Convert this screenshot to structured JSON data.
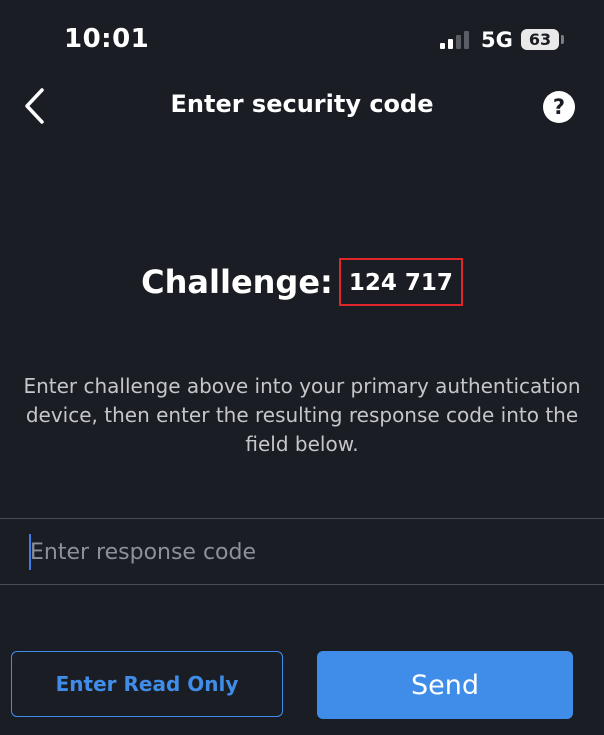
{
  "status_bar": {
    "time": "10:01",
    "network": "5G",
    "battery": "63",
    "signal_bars_active": 2,
    "signal_bars_total": 4
  },
  "nav": {
    "title": "Enter security code",
    "help_label": "?"
  },
  "challenge": {
    "label": "Challenge:",
    "code": "124 717"
  },
  "instructions": "Enter challenge above into your primary authentication device, then enter the resulting response code into the field below.",
  "response_field": {
    "placeholder": "Enter response code",
    "value": ""
  },
  "buttons": {
    "read_only": "Enter Read Only",
    "send": "Send"
  },
  "colors": {
    "background": "#1b1d24",
    "accent": "#3f8de9",
    "highlight_border": "#e0262b",
    "cursor": "#3f7be8"
  }
}
